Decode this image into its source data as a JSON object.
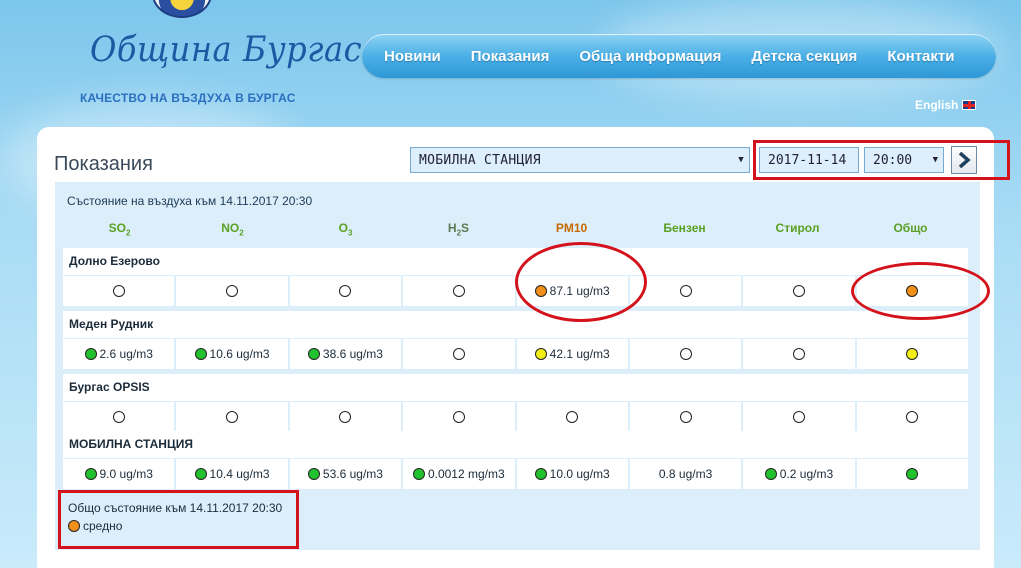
{
  "colors": {
    "green": "#22c22e",
    "yellow": "#f2ee13",
    "orange": "#f0901b",
    "empty": "#ffffff",
    "highlight": "#d4121c"
  },
  "header": {
    "logo_title": "Община Бургас",
    "logo_subtitle": "КАЧЕСТВО НА ВЪЗДУХА В БУРГАС",
    "language_link": "English"
  },
  "nav": {
    "items": [
      "Новини",
      "Показания",
      "Обща информация",
      "Детска секция",
      "Контакти"
    ]
  },
  "page": {
    "title": "Показания",
    "station_select_value": "МОБИЛНА СТАНЦИЯ",
    "date_value": "2017-11-14",
    "time_value": "20:00",
    "status_heading": "Състояние на въздуха към 14.11.2017 20:30"
  },
  "columns": [
    {
      "base": "SO",
      "sub": "2",
      "cls": ""
    },
    {
      "base": "NO",
      "sub": "2",
      "cls": ""
    },
    {
      "base": "O",
      "sub": "3",
      "cls": ""
    },
    {
      "base": "H",
      "sub": "2",
      "tail": "S",
      "cls": "gray"
    },
    {
      "base": "PM10",
      "sub": "",
      "cls": "pm"
    },
    {
      "base": "Бензен",
      "sub": "",
      "cls": ""
    },
    {
      "base": "Стирол",
      "sub": "",
      "cls": ""
    },
    {
      "base": "Общо",
      "sub": "",
      "cls": ""
    }
  ],
  "stations": [
    {
      "name": "Долно Езерово",
      "cells": [
        {
          "dot": "empty",
          "value": ""
        },
        {
          "dot": "empty",
          "value": ""
        },
        {
          "dot": "empty",
          "value": ""
        },
        {
          "dot": "empty",
          "value": ""
        },
        {
          "dot": "orange",
          "value": "87.1 ug/m3"
        },
        {
          "dot": "empty",
          "value": ""
        },
        {
          "dot": "empty",
          "value": ""
        },
        {
          "dot": "orange",
          "value": ""
        }
      ]
    },
    {
      "name": "Меден Рудник",
      "cells": [
        {
          "dot": "green",
          "value": "2.6 ug/m3"
        },
        {
          "dot": "green",
          "value": "10.6 ug/m3"
        },
        {
          "dot": "green",
          "value": "38.6 ug/m3"
        },
        {
          "dot": "empty",
          "value": ""
        },
        {
          "dot": "yellow",
          "value": "42.1 ug/m3"
        },
        {
          "dot": "empty",
          "value": ""
        },
        {
          "dot": "empty",
          "value": ""
        },
        {
          "dot": "yellow",
          "value": ""
        }
      ]
    },
    {
      "name": "Бургас OPSIS",
      "cells": [
        {
          "dot": "empty",
          "value": ""
        },
        {
          "dot": "empty",
          "value": ""
        },
        {
          "dot": "empty",
          "value": ""
        },
        {
          "dot": "empty",
          "value": ""
        },
        {
          "dot": "empty",
          "value": ""
        },
        {
          "dot": "empty",
          "value": ""
        },
        {
          "dot": "empty",
          "value": ""
        },
        {
          "dot": "empty",
          "value": ""
        }
      ]
    },
    {
      "name": "МОБИЛНА СТАНЦИЯ",
      "cells": [
        {
          "dot": "green",
          "value": "9.0 ug/m3"
        },
        {
          "dot": "green",
          "value": "10.4 ug/m3"
        },
        {
          "dot": "green",
          "value": "53.6 ug/m3"
        },
        {
          "dot": "green",
          "value": "0.0012 mg/m3"
        },
        {
          "dot": "green",
          "value": "10.0 ug/m3"
        },
        {
          "dot": "none",
          "value": "0.8 ug/m3"
        },
        {
          "dot": "green",
          "value": "0.2 ug/m3"
        },
        {
          "dot": "green",
          "value": ""
        }
      ]
    }
  ],
  "summary": {
    "heading": "Общо състояние към 14.11.2017 20:30",
    "level_dot": "orange",
    "level_label": "средно"
  }
}
